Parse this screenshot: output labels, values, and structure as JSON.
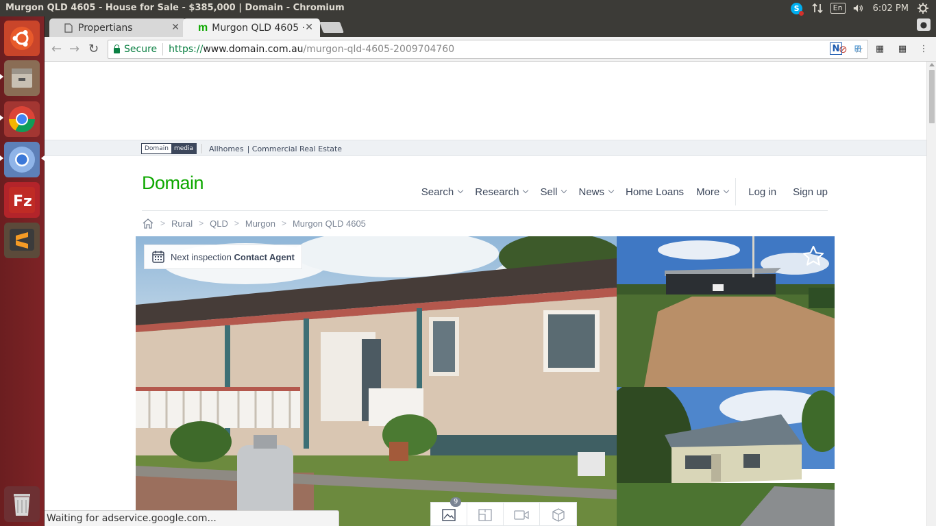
{
  "os": {
    "window_title": "Murgon QLD 4605 - House for Sale - $385,000 | Domain - Chromium",
    "tray": {
      "keyboard": "En",
      "clock": "6:02 PM"
    },
    "launcher": [
      "ubuntu-dash-icon",
      "files-icon",
      "chrome-icon",
      "chromium-icon",
      "filezilla-icon",
      "sublime-text-icon",
      "trash-icon"
    ]
  },
  "browser": {
    "tabs": [
      {
        "label": "Propertians",
        "active": false
      },
      {
        "label": "Murgon QLD 4605 ·",
        "active": true
      }
    ],
    "address": {
      "secure_label": "Secure",
      "url_proto": "https://",
      "url_host": "www.domain.com.au",
      "url_path": "/murgon-qld-4605-2009704760"
    },
    "status_text": "Waiting for adservice.google.com..."
  },
  "site": {
    "media_bar": {
      "logo_a": "Domain",
      "logo_b": "media",
      "link1": "Allhomes",
      "link2": "| Commercial Real Estate"
    },
    "logo": "Domain",
    "nav": [
      {
        "label": "Search",
        "dropdown": true
      },
      {
        "label": "Research",
        "dropdown": true
      },
      {
        "label": "Sell",
        "dropdown": true
      },
      {
        "label": "News",
        "dropdown": true
      },
      {
        "label": "Home Loans",
        "dropdown": false
      },
      {
        "label": "More",
        "dropdown": true
      }
    ],
    "auth": {
      "login": "Log in",
      "signup": "Sign up"
    },
    "breadcrumbs": [
      "Rural",
      "QLD",
      "Murgon",
      "Murgon QLD 4605"
    ],
    "inspection": {
      "prefix": "Next inspection",
      "value": "Contact Agent"
    },
    "gallery": {
      "photo_count": "9"
    },
    "colors": {
      "brand": "#0ea800",
      "text": "#3c475b"
    }
  }
}
